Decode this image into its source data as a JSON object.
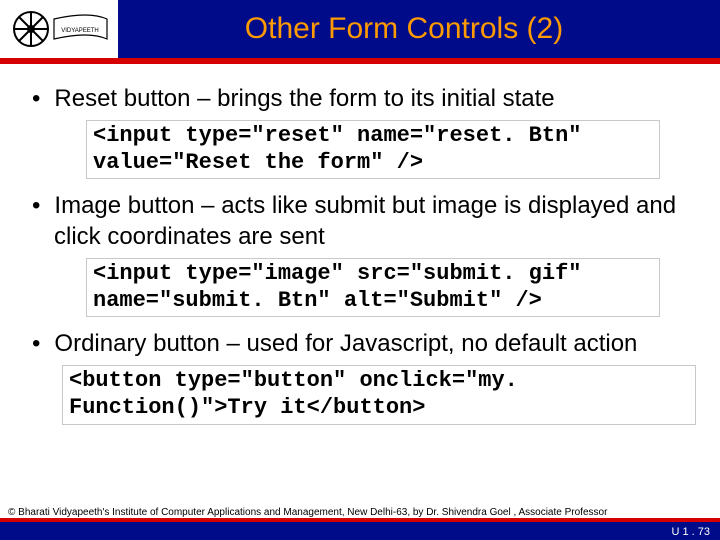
{
  "header": {
    "title": "Other Form Controls (2)"
  },
  "bullets": {
    "b1": "Reset button – brings the form to its initial state",
    "b2": "Image button – acts like submit but image is displayed and click coordinates are sent",
    "b3": "Ordinary button – used for Javascript, no default action"
  },
  "code": {
    "c1": "<input type=\"reset\" name=\"reset. Btn\" value=\"Reset the form\" />",
    "c2": "<input type=\"image\" src=\"submit. gif\" name=\"submit. Btn\" alt=\"Submit\" />",
    "c3": "<button type=\"button\" onclick=\"my. Function()\">Try it</button>"
  },
  "footer": {
    "copyright": "© Bharati Vidyapeeth's Institute of Computer Applications and Management, New Delhi-63, by Dr. Shivendra Goel , Associate Professor",
    "pageno": "U 1 . 73"
  }
}
